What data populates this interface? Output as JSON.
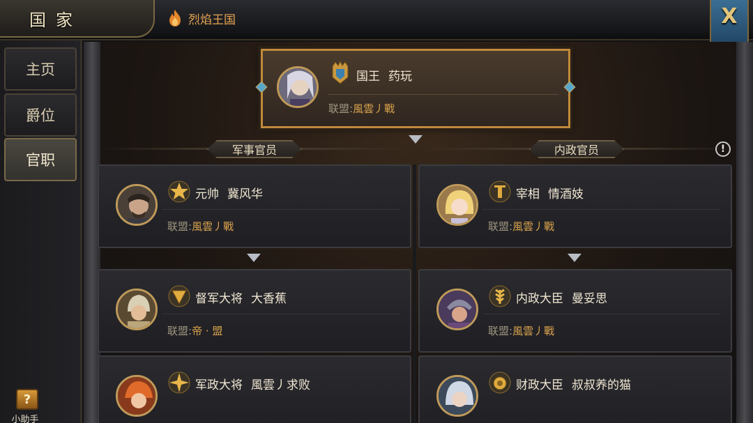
{
  "header": {
    "title": "国家",
    "kingdom_name": "烈焰王国",
    "close_label": "X"
  },
  "sidebar": {
    "tabs": [
      {
        "label": "主页"
      },
      {
        "label": "爵位"
      },
      {
        "label": "官职"
      }
    ],
    "active_tab": "官职",
    "helper_label": "小助手",
    "helper_icon_glyph": "?"
  },
  "king": {
    "role": "国王",
    "name": "药玩",
    "alliance_label": "联盟:",
    "alliance": "風雲丿戰"
  },
  "sections": {
    "military": "军事官员",
    "civil": "内政官员",
    "alert_glyph": "!"
  },
  "military": [
    {
      "role": "元帅",
      "name": "冀风华",
      "alliance_label": "联盟:",
      "alliance": "風雲丿戰"
    },
    {
      "role": "督军大将",
      "name": "大香蕉",
      "alliance_label": "联盟:",
      "alliance": "帝 · 盟"
    },
    {
      "role": "军政大将",
      "name": "風雲丿求败"
    }
  ],
  "civil": [
    {
      "role": "宰相",
      "name": "情酒妓",
      "alliance_label": "联盟:",
      "alliance": "風雲丿戰"
    },
    {
      "role": "内政大臣",
      "name": "曼妥思",
      "alliance_label": "联盟:",
      "alliance": "風雲丿戰"
    },
    {
      "role": "财政大臣",
      "name": "叔叔养的猫"
    }
  ],
  "colors": {
    "accent_gold": "#d9a24c",
    "kingdom_orange": "#e6a452",
    "close_blue": "#2f5c80"
  }
}
